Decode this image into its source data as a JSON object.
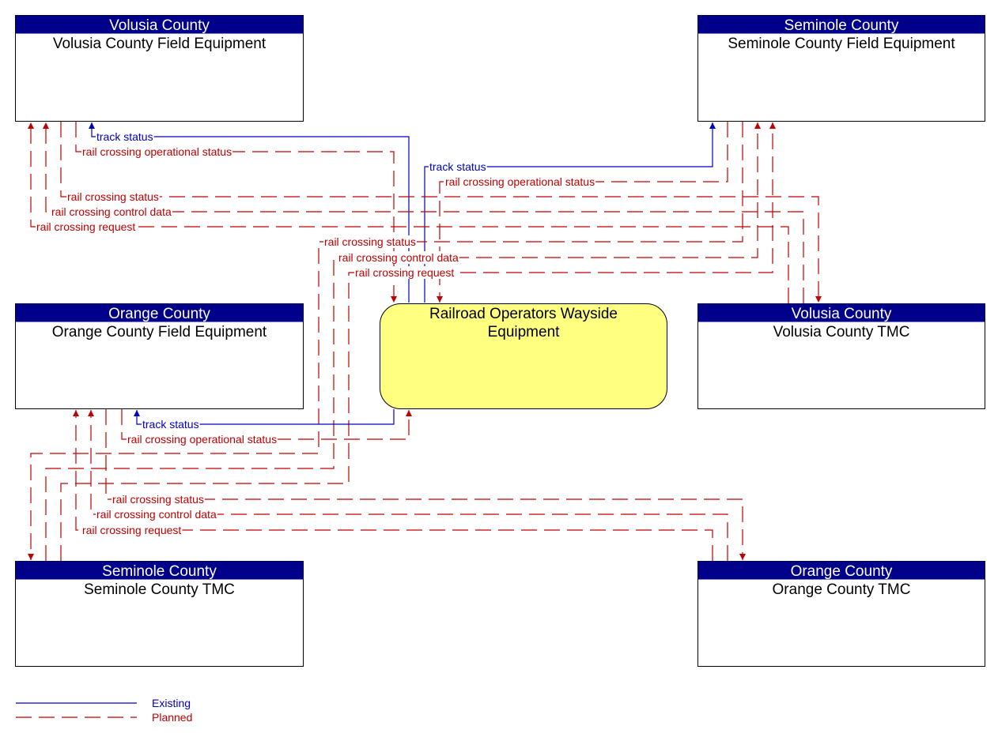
{
  "colors": {
    "header": "#00008b",
    "center_fill": "#ffff80",
    "existing": "#0000c0",
    "planned": "#c00000"
  },
  "nodes": {
    "volusia_field": {
      "group": "Volusia County",
      "name": "Volusia County Field Equipment"
    },
    "seminole_field": {
      "group": "Seminole County",
      "name": "Seminole County Field Equipment"
    },
    "orange_field": {
      "group": "Orange County",
      "name": "Orange County Field Equipment"
    },
    "wayside": {
      "name_line1": "Railroad Operators Wayside",
      "name_line2": "Equipment"
    },
    "volusia_tmc": {
      "group": "Volusia County",
      "name": "Volusia County TMC"
    },
    "seminole_tmc": {
      "group": "Seminole County",
      "name": "Seminole County TMC"
    },
    "orange_tmc": {
      "group": "Orange County",
      "name": "Orange County TMC"
    }
  },
  "flows": [
    {
      "label": "track status",
      "status": "existing",
      "from": "Railroad Operators Wayside Equipment",
      "to": "Volusia County Field Equipment"
    },
    {
      "label": "rail crossing operational status",
      "status": "planned",
      "from": "Volusia County Field Equipment",
      "to": "Railroad Operators Wayside Equipment"
    },
    {
      "label": "track status",
      "status": "existing",
      "from": "Railroad Operators Wayside Equipment",
      "to": "Seminole County Field Equipment"
    },
    {
      "label": "rail crossing operational status",
      "status": "planned",
      "from": "Seminole County Field Equipment",
      "to": "Railroad Operators Wayside Equipment"
    },
    {
      "label": "rail crossing status",
      "status": "planned",
      "from": "Volusia County Field Equipment",
      "to": "Volusia County TMC"
    },
    {
      "label": "rail crossing control data",
      "status": "planned",
      "from": "Volusia County TMC",
      "to": "Volusia County Field Equipment"
    },
    {
      "label": "rail crossing request",
      "status": "planned",
      "from": "Volusia County TMC",
      "to": "Volusia County Field Equipment"
    },
    {
      "label": "rail crossing status",
      "status": "planned",
      "from": "Seminole County Field Equipment",
      "to": "Seminole County TMC"
    },
    {
      "label": "rail crossing control data",
      "status": "planned",
      "from": "Seminole County TMC",
      "to": "Seminole County Field Equipment"
    },
    {
      "label": "rail crossing request",
      "status": "planned",
      "from": "Seminole County TMC",
      "to": "Seminole County Field Equipment"
    },
    {
      "label": "track status",
      "status": "existing",
      "from": "Railroad Operators Wayside Equipment",
      "to": "Orange County Field Equipment"
    },
    {
      "label": "rail crossing operational status",
      "status": "planned",
      "from": "Orange County Field Equipment",
      "to": "Railroad Operators Wayside Equipment"
    },
    {
      "label": "rail crossing status",
      "status": "planned",
      "from": "Orange County Field Equipment",
      "to": "Orange County TMC"
    },
    {
      "label": "rail crossing control data",
      "status": "planned",
      "from": "Orange County TMC",
      "to": "Orange County Field Equipment"
    },
    {
      "label": "rail crossing request",
      "status": "planned",
      "from": "Orange County TMC",
      "to": "Orange County Field Equipment"
    }
  ],
  "legend": {
    "existing_label": "Existing",
    "planned_label": "Planned"
  }
}
